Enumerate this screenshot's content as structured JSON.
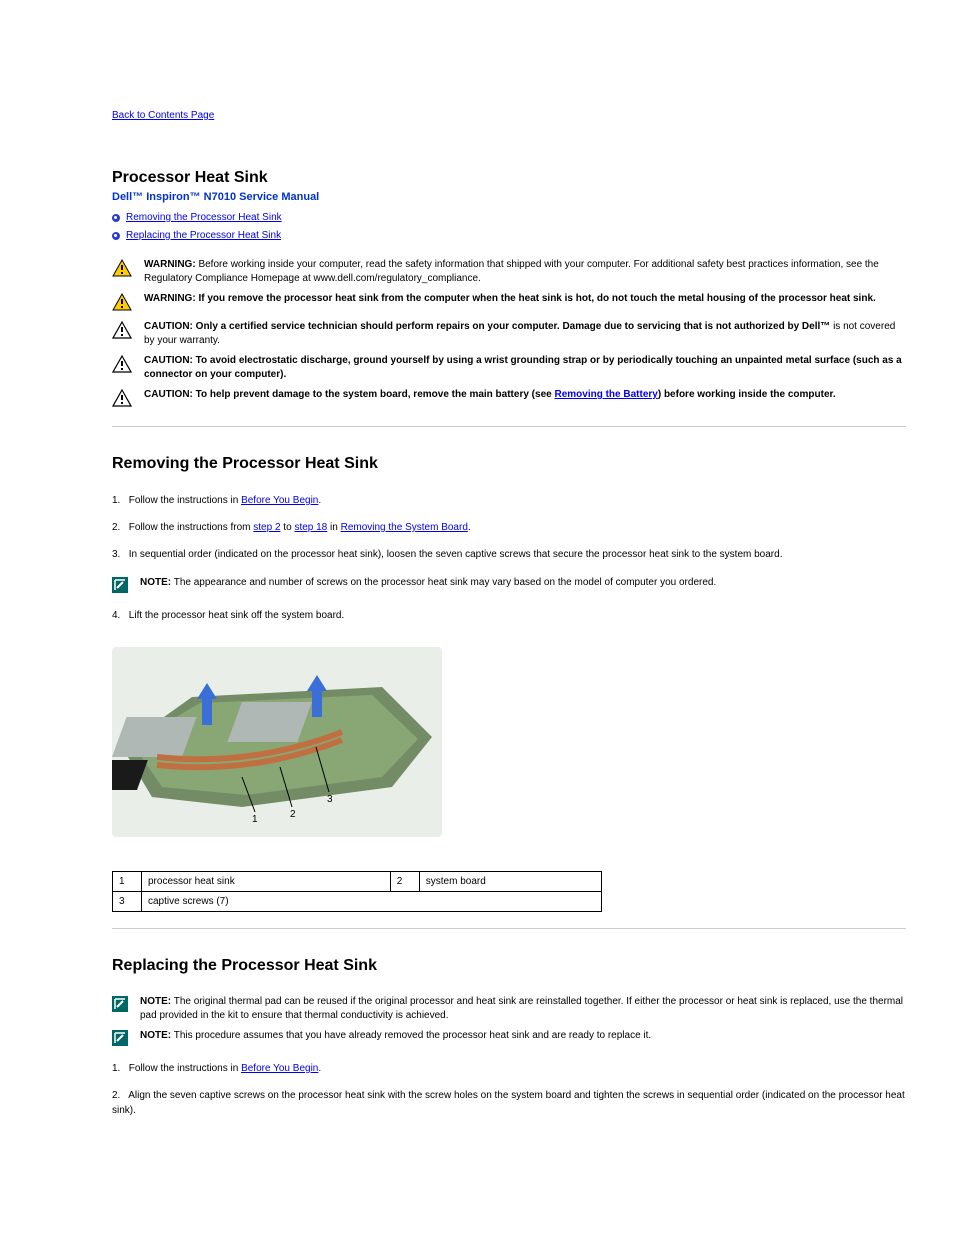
{
  "back_link": "Back to Contents Page",
  "page_title": "Processor Heat Sink",
  "manual_title": "Dell™ Inspiron™ N7010 Service Manual",
  "toc": {
    "remove": "Removing the Processor Heat Sink",
    "replace": "Replacing the Processor Heat Sink"
  },
  "notices": {
    "warn1": {
      "label": "WARNING:",
      "text": "Before working inside your computer, read the safety information that shipped with your computer. For additional safety best practices information, see the Regulatory Compliance Homepage at www.dell.com/regulatory_compliance."
    },
    "warn2": {
      "label": "WARNING:",
      "text": "If you remove the processor heat sink from the computer when the heat sink is hot, do not touch the metal housing of the processor heat sink."
    },
    "caut1": {
      "label": "CAUTION:",
      "text_prefix": "Only a certified service technician should perform repairs on your computer. Damage due to servicing that is not authorized by Dell™",
      "text_suffix": " is not covered by your warranty."
    },
    "caut2": {
      "label": "CAUTION:",
      "text": "To avoid electrostatic discharge, ground yourself by using a wrist grounding strap or by periodically touching an unpainted metal surface (such as a connector on your computer)."
    },
    "caut3": {
      "label": "CAUTION:",
      "text_before": "To help prevent damage to the system board, remove the main battery (see ",
      "link": "Removing the Battery",
      "text_after": ") before working inside the computer."
    }
  },
  "section_remove": {
    "title": "Removing the Processor Heat Sink",
    "steps": [
      {
        "n": "1.",
        "before": "Follow the instructions in ",
        "link": "Before You Begin",
        "after": "."
      },
      {
        "n": "2.",
        "before": "Follow the instructions from ",
        "link1": "step 2",
        "mid": " to ",
        "link2": "step 18",
        "mid2": " in ",
        "link3": "Removing the System Board",
        "after": "."
      },
      {
        "n": "3.",
        "plain": "In sequential order (indicated on the processor heat sink), loosen the seven captive screws that secure the processor heat sink to the system board."
      }
    ],
    "note": {
      "label": "NOTE:",
      "text": "The appearance and number of screws on the processor heat sink may vary based on the model of computer you ordered."
    },
    "step4": "Lift the processor heat sink off the system board.",
    "step4n": "4.",
    "callout": {
      "r1c1": "1",
      "r1c2": "processor heat sink",
      "r1c3": "2",
      "r1c4": "system board",
      "r2c1": "3",
      "r2c2": "captive screws (7)"
    }
  },
  "section_replace": {
    "title": "Replacing the Processor Heat Sink",
    "note1": {
      "label": "NOTE:",
      "text": "The original thermal pad can be reused if the original processor and heat sink are reinstalled together. If either the processor or heat sink is replaced, use the thermal pad provided in the kit to ensure that thermal conductivity is achieved."
    },
    "note2": {
      "label": "NOTE:",
      "text": "This procedure assumes that you have already removed the processor heat sink and are ready to replace it."
    },
    "steps": [
      {
        "n": "1.",
        "before": "Follow the instructions in ",
        "link": "Before You Begin",
        "after": "."
      },
      {
        "n": "2.",
        "plain": "Align the seven captive screws on the processor heat sink with the screw holes on the system board and tighten the screws in sequential order (indicated on the processor heat sink)."
      }
    ]
  }
}
